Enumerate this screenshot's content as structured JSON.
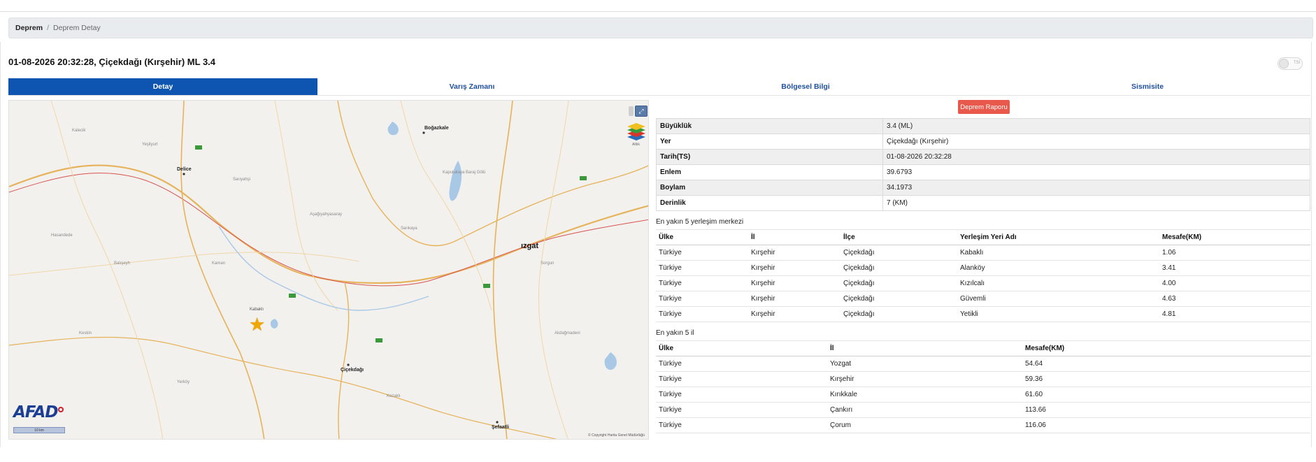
{
  "breadcrumb": {
    "home": "Deprem",
    "separator": "/",
    "current": "Deprem Detay"
  },
  "page_title": "01-08-2026 20:32:28, Çiçekdağı (Kırşehir) ML 3.4",
  "toggle_label": "TSİ",
  "tabs": [
    {
      "label": "Detay",
      "active": true
    },
    {
      "label": "Varış Zamanı",
      "active": false
    },
    {
      "label": "Bölgesel Bilgi",
      "active": false
    },
    {
      "label": "Sismisite",
      "active": false
    }
  ],
  "report_button": "Deprem Raporu",
  "details": [
    {
      "key": "Büyüklük",
      "value": "3.4 (ML)"
    },
    {
      "key": "Yer",
      "value": "Çiçekdağı (Kırşehir)"
    },
    {
      "key": "Tarih(TS)",
      "value": "01-08-2026 20:32:28"
    },
    {
      "key": "Enlem",
      "value": "39.6793"
    },
    {
      "key": "Boylam",
      "value": "34.1973"
    },
    {
      "key": "Derinlik",
      "value": "7 (KM)"
    }
  ],
  "nearest_settlements": {
    "title": "En yakın 5 yerleşim merkezi",
    "headers": [
      "Ülke",
      "İl",
      "İlçe",
      "Yerleşim Yeri Adı",
      "Mesafe(KM)"
    ],
    "rows": [
      [
        "Türkiye",
        "Kırşehir",
        "Çiçekdağı",
        "Kabaklı",
        "1.06"
      ],
      [
        "Türkiye",
        "Kırşehir",
        "Çiçekdağı",
        "Alanköy",
        "3.41"
      ],
      [
        "Türkiye",
        "Kırşehir",
        "Çiçekdağı",
        "Kızılcalı",
        "4.00"
      ],
      [
        "Türkiye",
        "Kırşehir",
        "Çiçekdağı",
        "Güvemli",
        "4.63"
      ],
      [
        "Türkiye",
        "Kırşehir",
        "Çiçekdağı",
        "Yetikli",
        "4.81"
      ]
    ]
  },
  "nearest_provinces": {
    "title": "En yakın 5 il",
    "headers": [
      "Ülke",
      "İl",
      "Mesafe(KM)"
    ],
    "rows": [
      [
        "Türkiye",
        "Yozgat",
        "54.64"
      ],
      [
        "Türkiye",
        "Kırşehir",
        "59.36"
      ],
      [
        "Türkiye",
        "Kırıkkale",
        "61.60"
      ],
      [
        "Türkiye",
        "Çankırı",
        "113.66"
      ],
      [
        "Türkiye",
        "Çorum",
        "116.06"
      ]
    ]
  },
  "map": {
    "big_city": "ızgat",
    "cities": [
      "Delice",
      "Boğazkale",
      "Çiçekdağı",
      "Şefaatli",
      "Kabaklı"
    ],
    "lake_label": "Kapulukaya Baraj Gölü",
    "layer_label": "Altlık",
    "logo": "AFAD",
    "scale": "10 km",
    "copyright": "© Copyright Harita Genel Müdürlüğü",
    "marker_icon": "star-icon",
    "colors": {
      "marker": "#f0a800",
      "logo": "#1c3f94",
      "road": "#e6b35a",
      "rail": "#d9534f"
    }
  },
  "colors": {
    "tab_active": "#0d55b0",
    "report_button": "#e8594b"
  }
}
